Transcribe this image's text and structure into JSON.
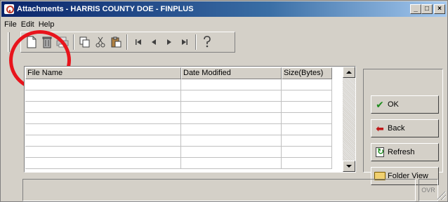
{
  "window": {
    "title": "Attachments - HARRIS COUNTY DOE - FINPLUS",
    "minimize_label": "_",
    "maximize_label": "□",
    "close_label": "×"
  },
  "menu": [
    {
      "label": "File"
    },
    {
      "label": "Edit"
    },
    {
      "label": "Help"
    }
  ],
  "toolbar": {
    "icons": [
      "new-document-icon",
      "delete-trash-icon",
      "print-icon",
      "copy-icon",
      "cut-icon",
      "paste-icon",
      "first-record-icon",
      "previous-record-icon",
      "next-record-icon",
      "last-record-icon",
      "help-icon"
    ]
  },
  "table": {
    "columns": [
      "File Name",
      "Date Modified",
      "Size(Bytes)"
    ],
    "rows": [
      [
        "",
        "",
        ""
      ],
      [
        "",
        "",
        ""
      ],
      [
        "",
        "",
        ""
      ],
      [
        "",
        "",
        ""
      ],
      [
        "",
        "",
        ""
      ],
      [
        "",
        "",
        ""
      ],
      [
        "",
        "",
        ""
      ],
      [
        "",
        "",
        ""
      ]
    ]
  },
  "buttons": {
    "ok": "OK",
    "back": "Back",
    "refresh": "Refresh",
    "folder_view": "Folder View"
  },
  "statusbar": {
    "ovr": "OVR"
  },
  "annotation": {
    "color": "#e8141c"
  }
}
